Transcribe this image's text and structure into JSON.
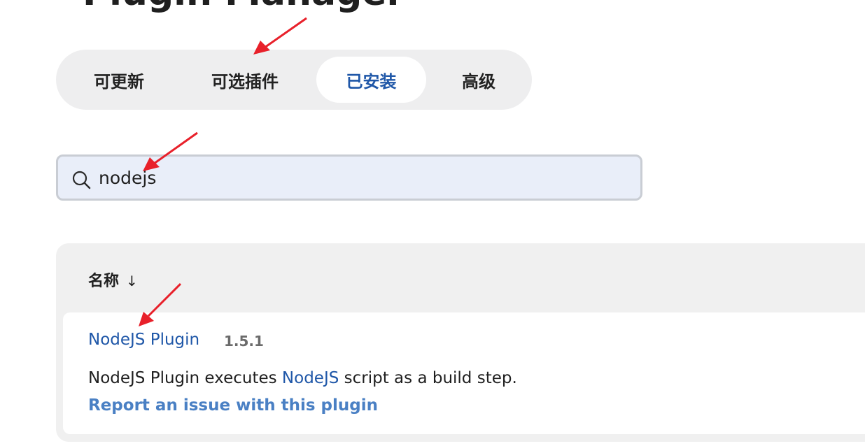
{
  "page": {
    "title": "Plugin Manager"
  },
  "tabs": [
    {
      "label": "可更新",
      "active": false
    },
    {
      "label": "可选插件",
      "active": false
    },
    {
      "label": "已安装",
      "active": true
    },
    {
      "label": "高级",
      "active": false
    }
  ],
  "search": {
    "value": "nodejs",
    "icon": "search-icon"
  },
  "table": {
    "header": {
      "name_label": "名称",
      "sort_indicator": "↓"
    },
    "rows": [
      {
        "name": "NodeJS Plugin",
        "version": "1.5.1",
        "description_prefix": "NodeJS Plugin executes ",
        "description_link": "NodeJS",
        "description_suffix": " script as a build step.",
        "report_link": "Report an issue with this plugin"
      }
    ]
  },
  "colors": {
    "accent": "#1f57a8",
    "link_light": "#4a80c4",
    "annotation_arrow": "#e8202a",
    "tabbar_bg": "#eeeeef",
    "search_bg": "#e9eef9"
  }
}
